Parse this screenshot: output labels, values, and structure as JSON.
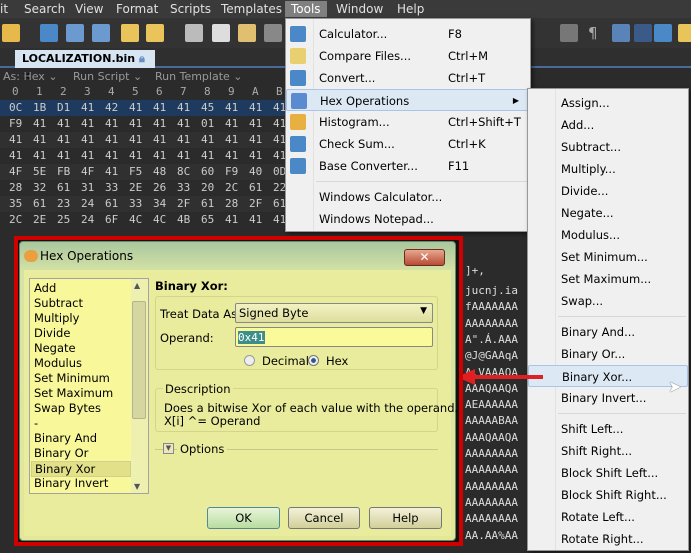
{
  "menubar": {
    "items": [
      "it",
      "Search",
      "View",
      "Format",
      "Scripts",
      "Templates",
      "Tools",
      "Window",
      "Help"
    ],
    "active": "Tools"
  },
  "tab": {
    "label": "LOCALIZATION.bin"
  },
  "subbar": {
    "as": "As: Hex",
    "run_script": "Run Script",
    "run_template": "Run Template"
  },
  "hex": {
    "columns": [
      "0",
      "1",
      "2",
      "3",
      "4",
      "5",
      "6",
      "7",
      "8",
      "9",
      "A",
      "B"
    ],
    "rows": [
      [
        "0C",
        "1B",
        "D1",
        "41",
        "42",
        "41",
        "41",
        "41",
        "45",
        "41",
        "41",
        "41"
      ],
      [
        "F9",
        "41",
        "41",
        "41",
        "41",
        "41",
        "41",
        "41",
        "01",
        "41",
        "41",
        "41"
      ],
      [
        "41",
        "41",
        "41",
        "41",
        "41",
        "41",
        "41",
        "41",
        "41",
        "41",
        "41",
        "41"
      ],
      [
        "41",
        "41",
        "41",
        "41",
        "41",
        "41",
        "41",
        "41",
        "41",
        "41",
        "41",
        "41"
      ],
      [
        "4F",
        "5E",
        "FB",
        "4F",
        "41",
        "F5",
        "48",
        "8C",
        "60",
        "F9",
        "40",
        "0D"
      ],
      [
        "28",
        "32",
        "61",
        "31",
        "33",
        "2E",
        "26",
        "33",
        "20",
        "2C",
        "61",
        "22"
      ],
      [
        "35",
        "61",
        "23",
        "24",
        "61",
        "33",
        "34",
        "2F",
        "61",
        "28",
        "2F",
        "61"
      ],
      [
        "2C",
        "2E",
        "25",
        "24",
        "6F",
        "4C",
        "4C",
        "4B",
        "65",
        "41",
        "41",
        "41"
      ]
    ],
    "ascii_fragments": [
      "]+,",
      "jucnj.ia",
      "fAAAAAAA",
      "AAAAAAAA",
      "A\".Á.AAA",
      "@J@GAAqA",
      "A.VAAAQA",
      "AAAQAAQA",
      "AEAAAAAA",
      "AAAAABAA",
      "AAAQAAQA",
      "AAAAAAAA",
      "AAAAAAAA",
      "AAAAAAAA",
      "AAAAAAAA",
      "AAAAAAAA",
      "AA.AA%AA"
    ]
  },
  "tools_menu": {
    "items": [
      {
        "label": "Calculator...",
        "shortcut": "F8",
        "icon": "calculator-icon"
      },
      {
        "label": "Compare Files...",
        "shortcut": "Ctrl+M",
        "icon": "compare-files-icon"
      },
      {
        "label": "Convert...",
        "shortcut": "Ctrl+T",
        "icon": "convert-icon"
      },
      {
        "label": "Hex Operations",
        "shortcut": "",
        "icon": "hex-operations-icon",
        "submenu": true
      },
      {
        "label": "Histogram...",
        "shortcut": "Ctrl+Shift+T",
        "icon": "histogram-icon"
      },
      {
        "label": "Check Sum...",
        "shortcut": "Ctrl+K",
        "icon": "checksum-icon"
      },
      {
        "label": "Base Converter...",
        "shortcut": "F11",
        "icon": "base-converter-icon"
      },
      {
        "label": "Windows Calculator...",
        "shortcut": ""
      },
      {
        "label": "Windows Notepad...",
        "shortcut": ""
      }
    ]
  },
  "hex_ops_submenu": {
    "groups": [
      [
        "Assign...",
        "Add...",
        "Subtract...",
        "Multiply...",
        "Divide...",
        "Negate...",
        "Modulus...",
        "Set Minimum...",
        "Set Maximum...",
        "Swap..."
      ],
      [
        "Binary And...",
        "Binary Or...",
        "Binary Xor...",
        "Binary Invert..."
      ],
      [
        "Shift Left...",
        "Shift Right...",
        "Block Shift Left...",
        "Block Shift Right...",
        "Rotate Left...",
        "Rotate Right..."
      ]
    ],
    "highlighted": "Binary Xor..."
  },
  "dialog": {
    "title": "Hex Operations",
    "close": "✕",
    "operations": [
      "Add",
      "Subtract",
      "Multiply",
      "Divide",
      "Negate",
      "Modulus",
      "Set Minimum",
      "Set Maximum",
      "Swap Bytes",
      "-",
      "Binary And",
      "Binary Or",
      "Binary Xor",
      "Binary Invert"
    ],
    "selected": "Binary Xor",
    "heading": "Binary Xor:",
    "treat_label": "Treat Data As:",
    "treat_value": "Signed Byte",
    "operand_label": "Operand:",
    "operand_value": "0x41",
    "radio_decimal": "Decimal",
    "radio_hex": "Hex",
    "radio_selected": "Hex",
    "description_label": "Description",
    "description_line1": "Does a bitwise Xor of each value with the operand.",
    "description_line2": "X[i]  ^= Operand",
    "options_label": "Options",
    "ok": "OK",
    "cancel": "Cancel",
    "help": "Help"
  },
  "colors": {
    "highlight_border": "#d00000",
    "arrow": "#e02020",
    "dialog_bg": "#e3e79a",
    "selected_row": "#1f3a5f"
  }
}
